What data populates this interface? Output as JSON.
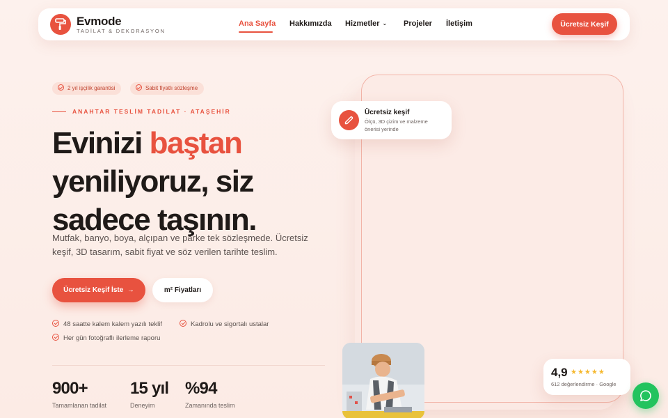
{
  "brand": {
    "name": "Evmode",
    "tagline": "TADİLAT & DEKORASYON"
  },
  "nav": {
    "items": [
      {
        "label": "Ana Sayfa"
      },
      {
        "label": "Hakkımızda"
      },
      {
        "label": "Hizmetler"
      },
      {
        "label": "Projeler"
      },
      {
        "label": "İletişim"
      }
    ],
    "cta": "Ücretsiz Keşif"
  },
  "hero": {
    "badges": [
      "2 yıl işçilik garantisi",
      "Sabit fiyatlı sözleşme"
    ],
    "eyebrow": "ANAHTAR TESLİM TADİLAT · ATAŞEHİR",
    "title_part1": "Evinizi ",
    "title_accent": "baştan",
    "title_part2": "yeniliyoruz, siz",
    "title_part3": "sadece taşının.",
    "lead": "Mutfak, banyo, boya, alçıpan ve parke tek sözleşmede. Ücretsiz keşif, 3D tasarım, sabit fiyat ve söz verilen tarihte teslim.",
    "primary_cta": "Ücretsiz Keşif İste",
    "secondary_cta": "m² Fiyatları",
    "checks": [
      "48 saatte kalem kalem yazılı teklif",
      "Kadrolu ve sigortalı ustalar",
      "Her gün fotoğraflı ilerleme raporu"
    ],
    "stats": [
      {
        "value": "900+",
        "label": "Tamamlanan tadilat"
      },
      {
        "value": "15 yıl",
        "label": "Deneyim"
      },
      {
        "value": "%94",
        "label": "Zamanında teslim"
      }
    ]
  },
  "float_card": {
    "title": "Ücretsiz keşif",
    "subtitle": "Ölçü, 3D çizim ve malzeme önerisi yerinde"
  },
  "rating": {
    "score": "4,9",
    "stars": "★★★★★",
    "subtitle": "612 değerlendirme · Google"
  },
  "colors": {
    "accent": "#e8523f",
    "background": "#fdeee9",
    "star": "#f5b82e",
    "chat": "#22c35e"
  },
  "icons": {
    "logo": "paint-roller-icon",
    "float": "pen-ruler-icon",
    "chat": "chat-bubble-icon"
  }
}
